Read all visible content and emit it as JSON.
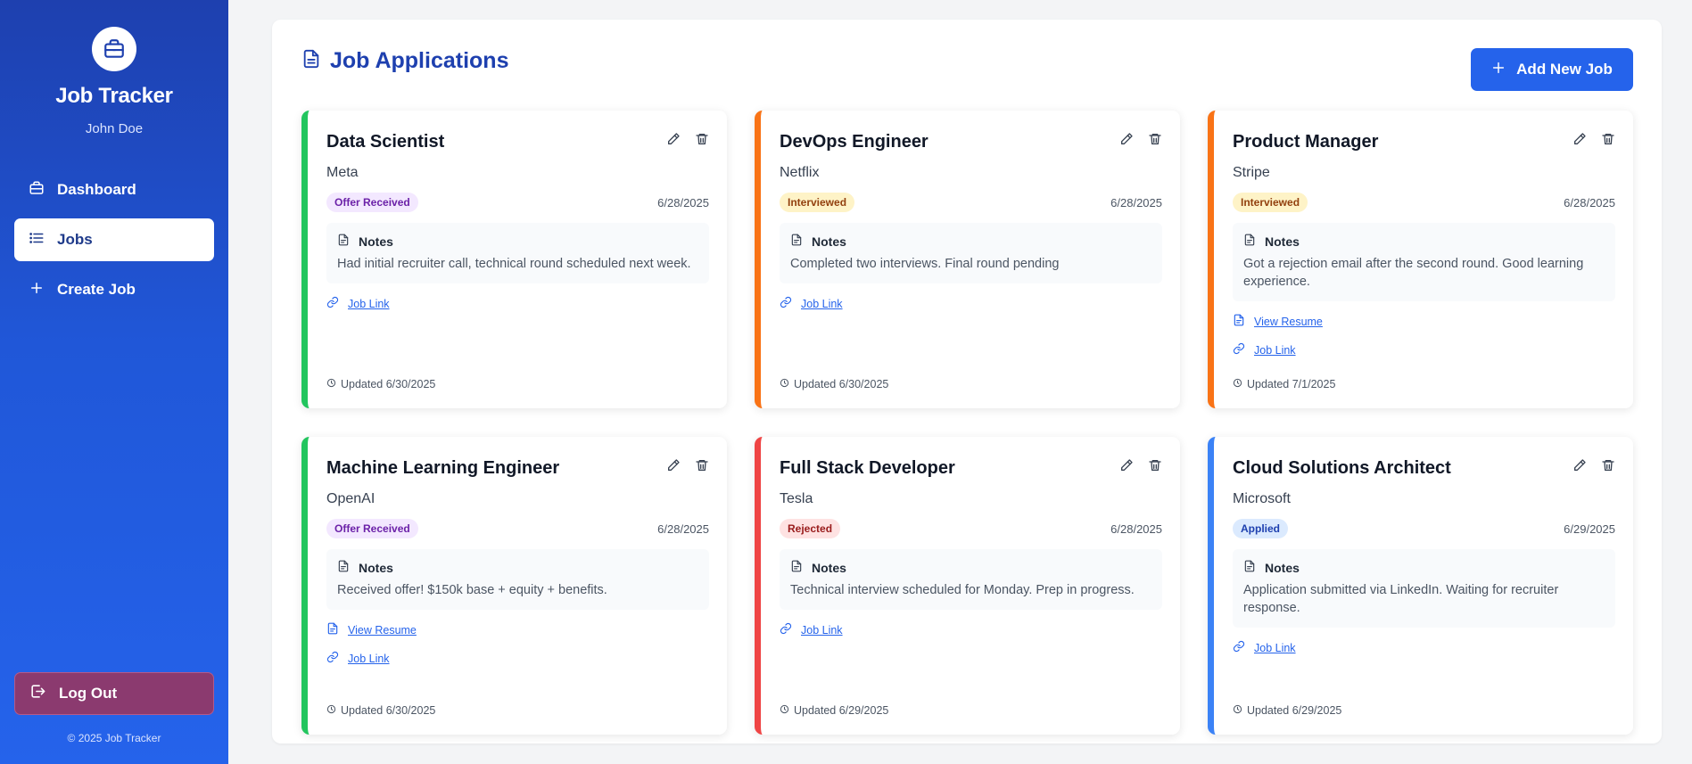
{
  "colors": {
    "primary": "#2563eb",
    "status_offer": "#22c55e",
    "status_interviewed": "#f97316",
    "status_rejected": "#ef4444",
    "status_applied": "#3b82f6"
  },
  "sidebar": {
    "brand_icon": "briefcase-icon",
    "app_title": "Job Tracker",
    "user_name": "John Doe",
    "nav": [
      {
        "label": "Dashboard",
        "icon": "briefcase-icon",
        "active": false
      },
      {
        "label": "Jobs",
        "icon": "list-icon",
        "active": true
      },
      {
        "label": "Create Job",
        "icon": "plus-icon",
        "active": false
      }
    ],
    "logout_label": "Log Out",
    "copyright": "© 2025 Job Tracker"
  },
  "main": {
    "title": "Job Applications",
    "add_button_label": "Add New Job"
  },
  "jobs": [
    {
      "title": "Data Scientist",
      "company": "Meta",
      "status": "Offer Received",
      "status_color": "#22c55e",
      "date": "6/28/2025",
      "notes_label": "Notes",
      "notes": "Had initial recruiter call, technical round scheduled next week.",
      "resume_link": "",
      "job_link": "Job Link",
      "updated": "Updated 6/30/2025"
    },
    {
      "title": "DevOps Engineer",
      "company": "Netflix",
      "status": "Interviewed",
      "status_color": "#f97316",
      "date": "6/28/2025",
      "notes_label": "Notes",
      "notes": "Completed two interviews. Final round pending",
      "resume_link": "",
      "job_link": "Job Link",
      "updated": "Updated 6/30/2025"
    },
    {
      "title": "Product Manager",
      "company": "Stripe",
      "status": "Interviewed",
      "status_color": "#f97316",
      "date": "6/28/2025",
      "notes_label": "Notes",
      "notes": "Got a rejection email after the second round. Good learning experience.",
      "resume_link": "View Resume",
      "job_link": "Job Link",
      "updated": "Updated 7/1/2025"
    },
    {
      "title": "Machine Learning Engineer",
      "company": "OpenAI",
      "status": "Offer Received",
      "status_color": "#22c55e",
      "date": "6/28/2025",
      "notes_label": "Notes",
      "notes": "Received offer! $150k base + equity + benefits.",
      "resume_link": "View Resume",
      "job_link": "Job Link",
      "updated": "Updated 6/30/2025"
    },
    {
      "title": "Full Stack Developer",
      "company": "Tesla",
      "status": "Rejected",
      "status_color": "#ef4444",
      "date": "6/28/2025",
      "notes_label": "Notes",
      "notes": "Technical interview scheduled for Monday. Prep in progress.",
      "resume_link": "",
      "job_link": "Job Link",
      "updated": "Updated 6/29/2025"
    },
    {
      "title": "Cloud Solutions Architect",
      "company": "Microsoft",
      "status": "Applied",
      "status_color": "#3b82f6",
      "date": "6/29/2025",
      "notes_label": "Notes",
      "notes": "Application submitted via LinkedIn. Waiting for recruiter response.",
      "resume_link": "",
      "job_link": "Job Link",
      "updated": "Updated 6/29/2025"
    }
  ]
}
